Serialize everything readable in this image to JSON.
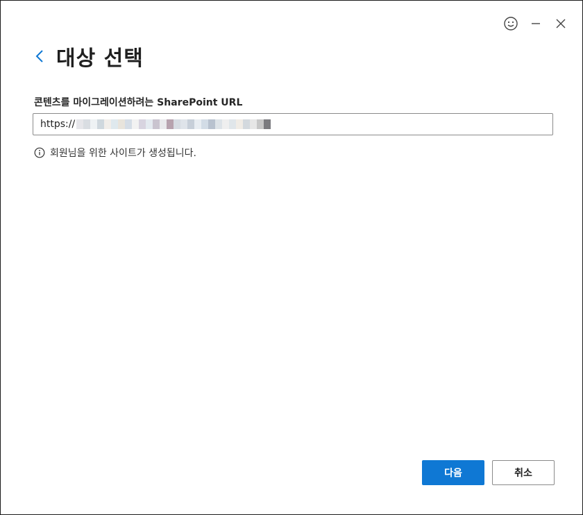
{
  "header": {
    "title": "대상 선택"
  },
  "titlebar": {
    "icons": [
      "feedback-smiley-icon",
      "minimize-icon",
      "close-icon"
    ]
  },
  "form": {
    "label": "콘텐츠를 마이그레이션하려는 SharePoint URL",
    "url_prefix": "https://",
    "url_obscured": true,
    "info_text": "회원님을 위한 사이트가 생성됩니다."
  },
  "buttons": {
    "next_label": "다음",
    "cancel_label": "취소"
  },
  "colors": {
    "accent": "#0f78d4",
    "back_chevron": "#0f78d4",
    "border": "#8a8a8a"
  }
}
